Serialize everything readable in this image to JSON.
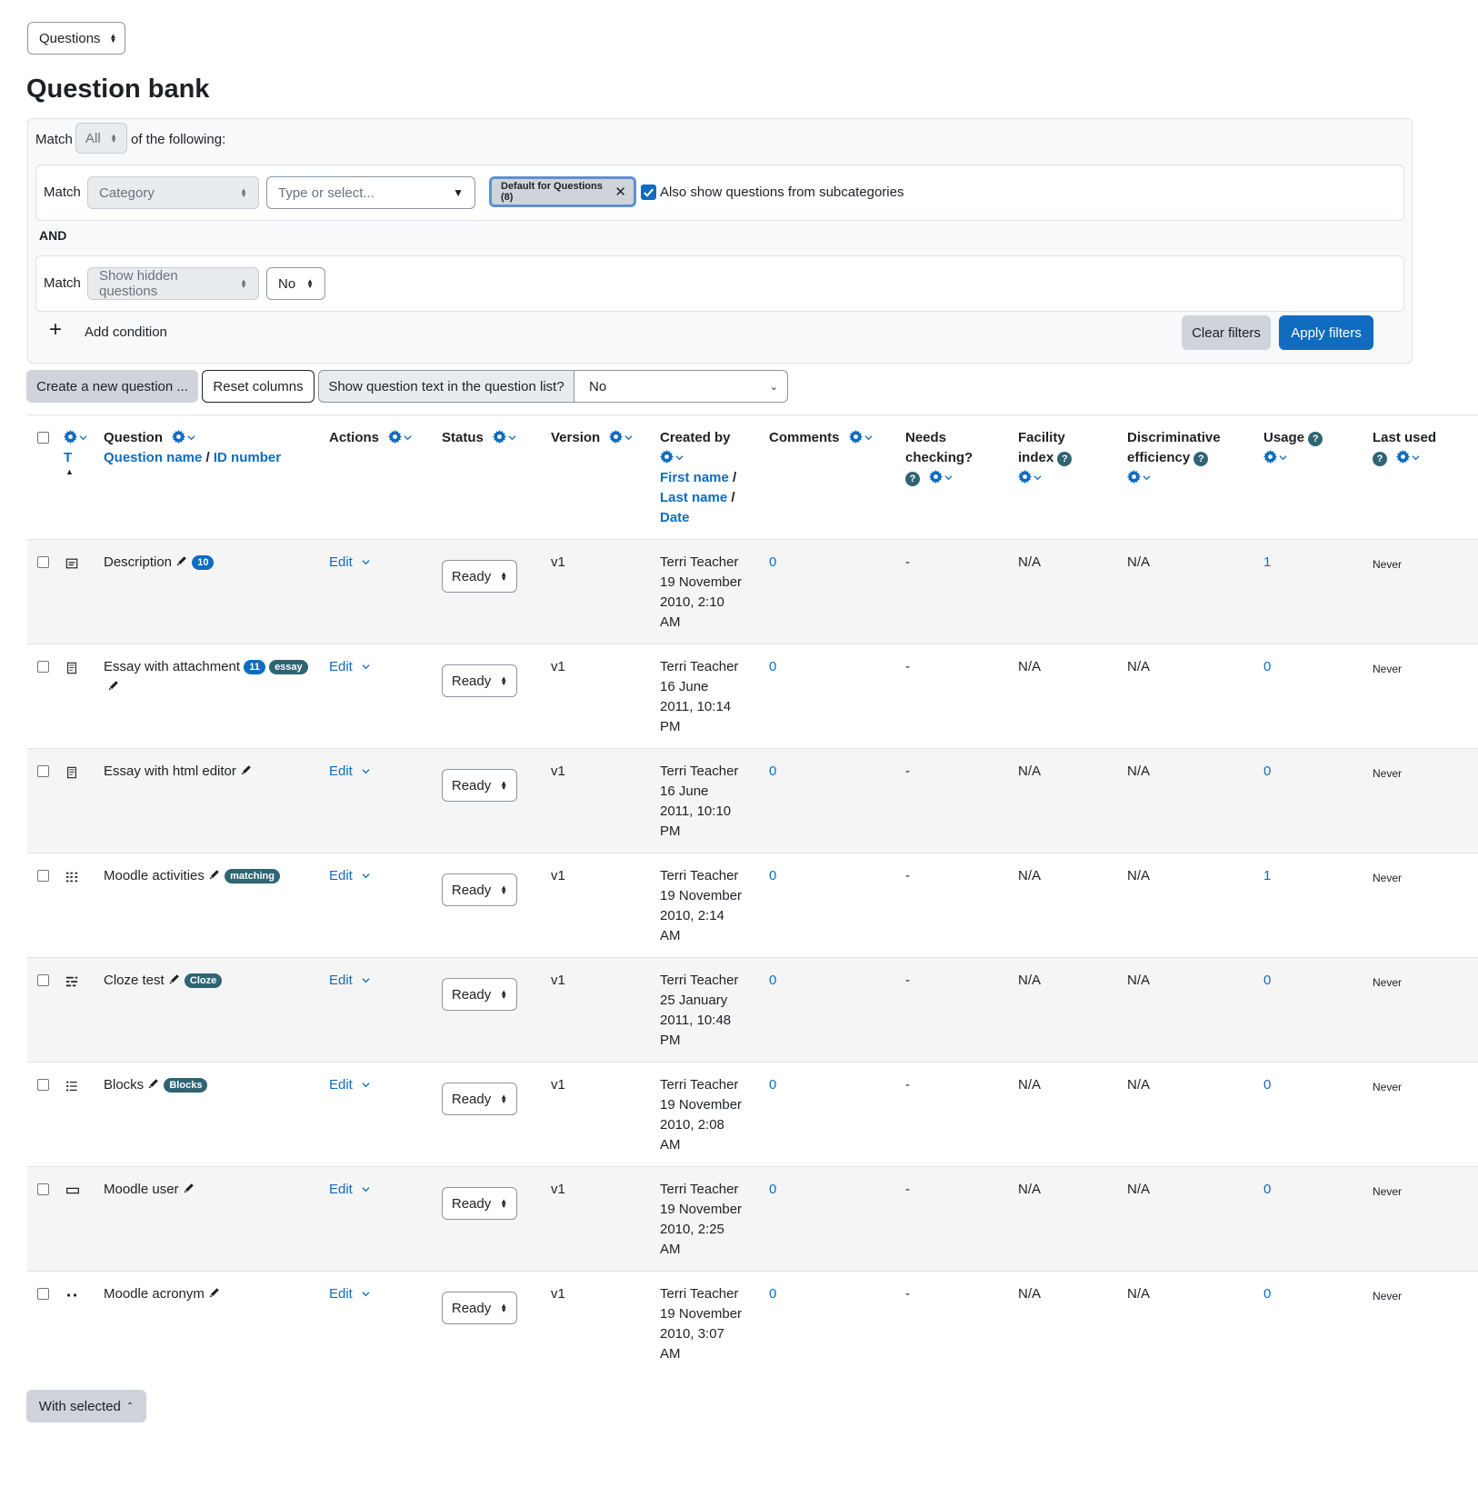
{
  "nav_select": "Questions",
  "page_title": "Question bank",
  "filters": {
    "match_label": "Match",
    "match_value": "All",
    "of_following": "of the following:",
    "cond1": {
      "match_label": "Match",
      "type": "Category",
      "placeholder": "Type or select...",
      "chip": "Default for Questions (8)",
      "subcat_label": "Also show questions from subcategories",
      "subcat_checked": true
    },
    "and_label": "AND",
    "cond2": {
      "match_label": "Match",
      "type": "Show hidden questions",
      "value": "No"
    },
    "add_condition": "Add condition",
    "clear": "Clear filters",
    "apply": "Apply filters"
  },
  "toolbar": {
    "create": "Create a new question ...",
    "reset": "Reset columns",
    "show_text_label": "Show question text in the question list?",
    "show_text_value": "No"
  },
  "columns": {
    "type_letter": "T",
    "question": "Question",
    "question_name": "Question name",
    "slash": "/",
    "id_number": "ID number",
    "actions": "Actions",
    "status": "Status",
    "version": "Version",
    "created_by": "Created by",
    "first_name": "First name",
    "last_name": "Last name",
    "date": "Date",
    "comments": "Comments",
    "needs_checking_1": "Needs",
    "needs_checking_2": "checking?",
    "facility_1": "Facility",
    "facility_2": "index",
    "disc_1": "Discriminative",
    "disc_2": "efficiency",
    "usage": "Usage",
    "last_used": "Last used"
  },
  "rows": [
    {
      "name": "Description",
      "id_badge": "10",
      "type_badge": "",
      "type_icon": "description-icon",
      "action": "Edit",
      "status": "Ready",
      "version": "v1",
      "created_l1": "Terri Teacher",
      "created_l2": "19 November",
      "created_l3": "2010, 2:10",
      "created_l4": "AM",
      "comments": "0",
      "needs": "-",
      "facility": "N/A",
      "disc": "N/A",
      "usage": "1",
      "last_used": "Never"
    },
    {
      "name": "Essay with attachment",
      "id_badge": "11",
      "type_badge": "essay",
      "type_icon": "essay-icon",
      "action": "Edit",
      "status": "Ready",
      "version": "v1",
      "created_l1": "Terri Teacher",
      "created_l2": "16 June",
      "created_l3": "2011, 10:14",
      "created_l4": "PM",
      "comments": "0",
      "needs": "-",
      "facility": "N/A",
      "disc": "N/A",
      "usage": "0",
      "last_used": "Never"
    },
    {
      "name": "Essay with html editor",
      "id_badge": "",
      "type_badge": "",
      "type_icon": "essay-icon",
      "action": "Edit",
      "status": "Ready",
      "version": "v1",
      "created_l1": "Terri Teacher",
      "created_l2": "16 June",
      "created_l3": "2011, 10:10",
      "created_l4": "PM",
      "comments": "0",
      "needs": "-",
      "facility": "N/A",
      "disc": "N/A",
      "usage": "0",
      "last_used": "Never"
    },
    {
      "name": "Moodle activities",
      "id_badge": "",
      "type_badge": "matching",
      "type_icon": "matching-icon",
      "action": "Edit",
      "status": "Ready",
      "version": "v1",
      "created_l1": "Terri Teacher",
      "created_l2": "19 November",
      "created_l3": "2010, 2:14",
      "created_l4": "AM",
      "comments": "0",
      "needs": "-",
      "facility": "N/A",
      "disc": "N/A",
      "usage": "1",
      "last_used": "Never"
    },
    {
      "name": "Cloze test",
      "id_badge": "",
      "type_badge": "Cloze",
      "type_icon": "cloze-icon",
      "action": "Edit",
      "status": "Ready",
      "version": "v1",
      "created_l1": "Terri Teacher",
      "created_l2": "25 January",
      "created_l3": "2011, 10:48",
      "created_l4": "PM",
      "comments": "0",
      "needs": "-",
      "facility": "N/A",
      "disc": "N/A",
      "usage": "0",
      "last_used": "Never"
    },
    {
      "name": "Blocks",
      "id_badge": "",
      "type_badge": "Blocks",
      "type_icon": "multichoice-icon",
      "action": "Edit",
      "status": "Ready",
      "version": "v1",
      "created_l1": "Terri Teacher",
      "created_l2": "19 November",
      "created_l3": "2010, 2:08",
      "created_l4": "AM",
      "comments": "0",
      "needs": "-",
      "facility": "N/A",
      "disc": "N/A",
      "usage": "0",
      "last_used": "Never"
    },
    {
      "name": "Moodle user",
      "id_badge": "",
      "type_badge": "",
      "type_icon": "shortanswer-icon",
      "action": "Edit",
      "status": "Ready",
      "version": "v1",
      "created_l1": "Terri Teacher",
      "created_l2": "19 November",
      "created_l3": "2010, 2:25",
      "created_l4": "AM",
      "comments": "0",
      "needs": "-",
      "facility": "N/A",
      "disc": "N/A",
      "usage": "0",
      "last_used": "Never"
    },
    {
      "name": "Moodle acronym",
      "id_badge": "",
      "type_badge": "",
      "type_icon": "truefalse-icon",
      "action": "Edit",
      "status": "Ready",
      "version": "v1",
      "created_l1": "Terri Teacher",
      "created_l2": "19 November",
      "created_l3": "2010, 3:07",
      "created_l4": "AM",
      "comments": "0",
      "needs": "-",
      "facility": "N/A",
      "disc": "N/A",
      "usage": "0",
      "last_used": "Never"
    }
  ],
  "with_selected": "With selected",
  "colors": {
    "primary": "#0f6cbf",
    "badge_teal": "#2f6473",
    "secondary_btn": "#ced4da"
  }
}
